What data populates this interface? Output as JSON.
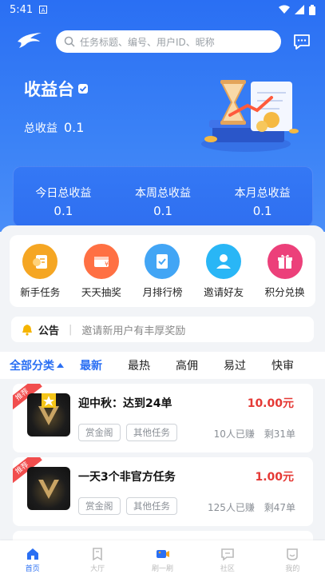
{
  "status_bar": {
    "time": "5:41"
  },
  "search": {
    "placeholder": "任务标题、编号、用户ID、昵称"
  },
  "earnings": {
    "title": "收益台",
    "total_label": "总收益",
    "total_value": "0.1"
  },
  "stats": [
    {
      "label": "今日总收益",
      "value": "0.1"
    },
    {
      "label": "本周总收益",
      "value": "0.1"
    },
    {
      "label": "本月总收益",
      "value": "0.1"
    }
  ],
  "quick_actions": [
    {
      "label": "新手任务",
      "icon": "newbie-task-icon",
      "color": "#f5a623"
    },
    {
      "label": "天天抽奖",
      "icon": "daily-lottery-icon",
      "color": "#ff7043"
    },
    {
      "label": "月排行榜",
      "icon": "monthly-ranking-icon",
      "color": "#42a5f5"
    },
    {
      "label": "邀请好友",
      "icon": "invite-friends-icon",
      "color": "#29b6f6"
    },
    {
      "label": "积分兑换",
      "icon": "points-exchange-icon",
      "color": "#ec407a"
    }
  ],
  "notice": {
    "tag": "公告",
    "text": "邀请新用户有丰厚奖励"
  },
  "tabs": {
    "all": "全部分类",
    "items": [
      "最新",
      "最热",
      "高佣",
      "易过",
      "快审"
    ]
  },
  "tasks": [
    {
      "badge": "推荐",
      "title": "迎中秋：达到24单",
      "price": "10.00元",
      "tags": [
        "赏金阁",
        "其他任务"
      ],
      "participants": "10人已赚",
      "remaining": "剩31单",
      "featured": true
    },
    {
      "badge": "推荐",
      "title": "一天3个非官方任务",
      "price": "1.00元",
      "tags": [
        "赏金阁",
        "其他任务"
      ],
      "participants": "125人已赚",
      "remaining": "剩47单",
      "featured": false
    }
  ],
  "bottom_nav": [
    {
      "label": "首页",
      "icon": "home-icon",
      "active": true
    },
    {
      "label": "大厅",
      "icon": "hall-icon",
      "active": false
    },
    {
      "label": "刷一刷",
      "icon": "video-icon",
      "active": false
    },
    {
      "label": "社区",
      "icon": "community-icon",
      "active": false
    },
    {
      "label": "我的",
      "icon": "profile-icon",
      "active": false
    }
  ],
  "colors": {
    "primary": "#2a6ff3",
    "price": "#e53935",
    "ribbon": "#f14d4d"
  }
}
